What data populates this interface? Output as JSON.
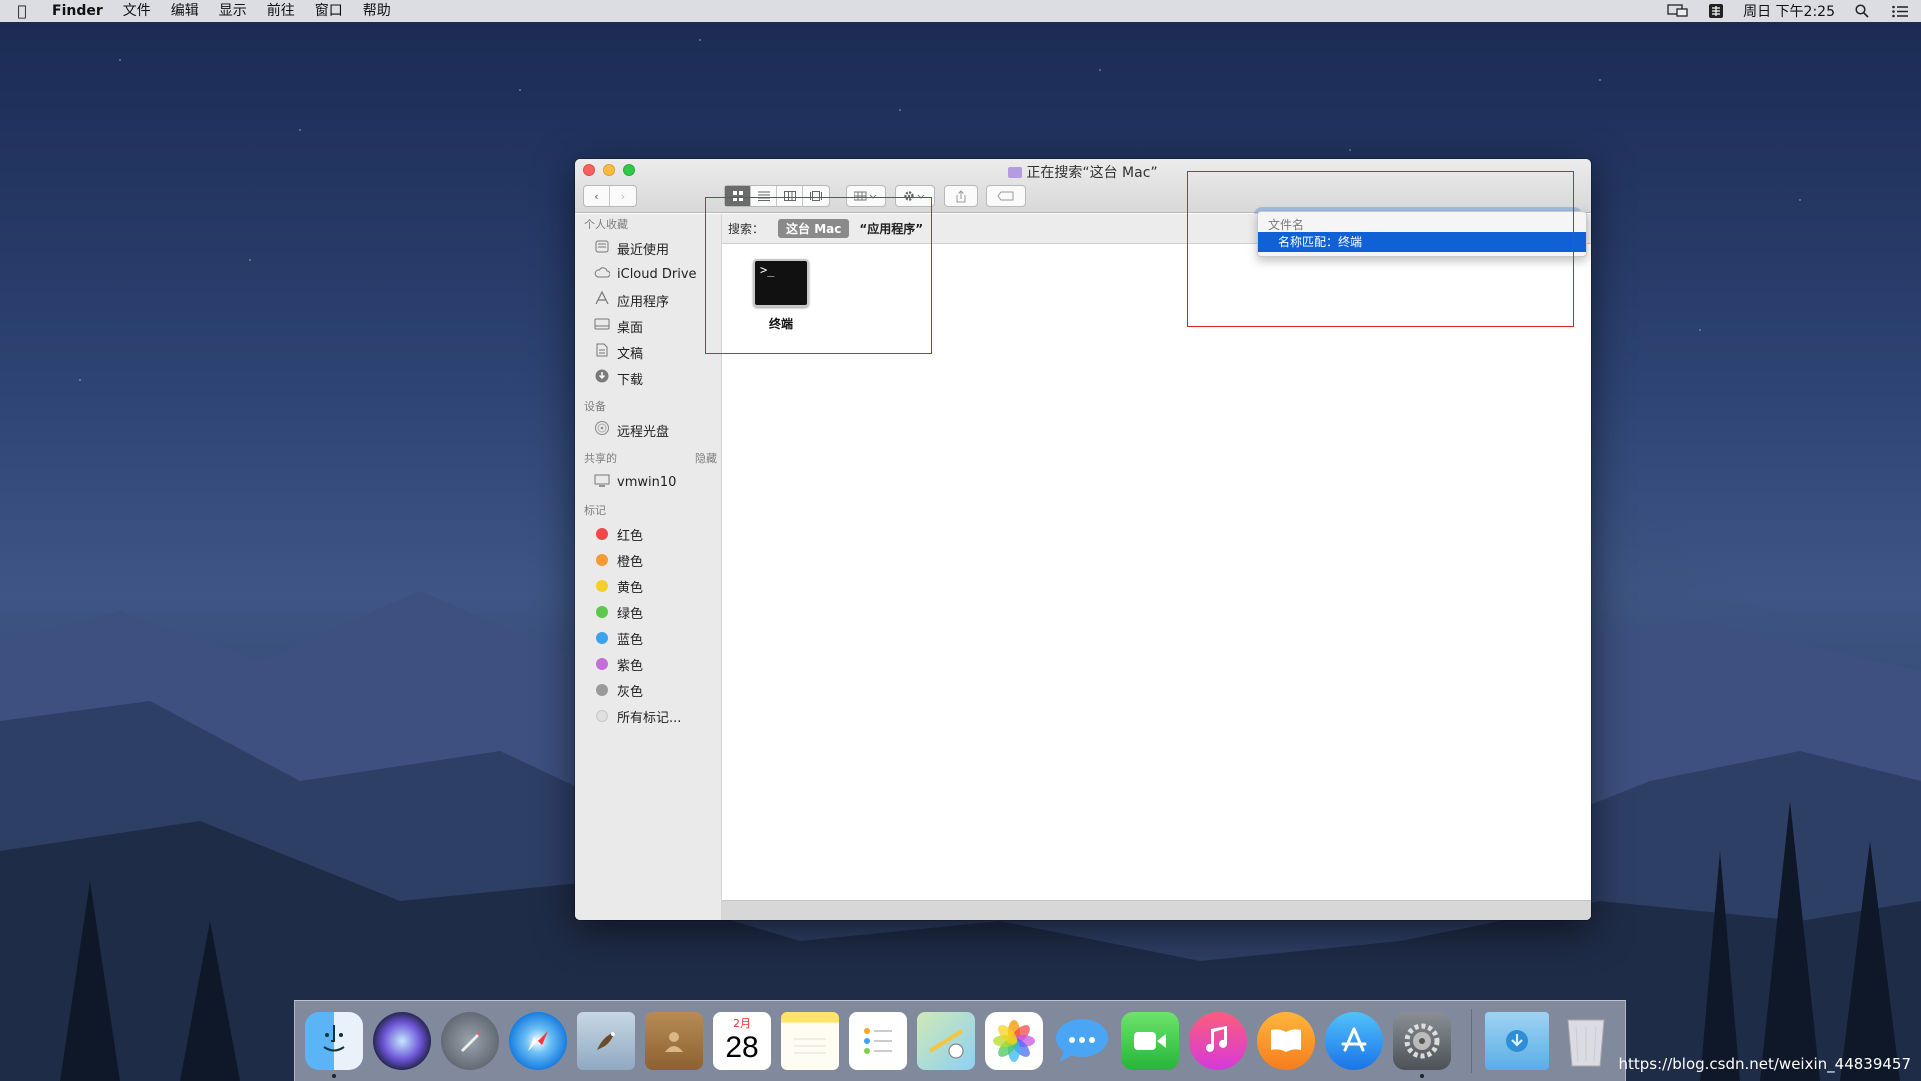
{
  "menubar": {
    "app_name": "Finder",
    "menus": [
      "文件",
      "编辑",
      "显示",
      "前往",
      "窗口",
      "帮助"
    ],
    "clock": "周日 下午2:25"
  },
  "window": {
    "title": "正在搜索“这台 Mac”"
  },
  "search": {
    "value": "终端",
    "suggestions_header": "文件名",
    "suggestion": "名称匹配：终端"
  },
  "scope": {
    "label": "搜索：",
    "this_mac": "这台 Mac",
    "applications": "“应用程序”"
  },
  "sidebar": {
    "favorites_header": "个人收藏",
    "favorites": [
      {
        "label": "最近使用",
        "icon": "clock-icon"
      },
      {
        "label": "iCloud Drive",
        "icon": "cloud-icon"
      },
      {
        "label": "应用程序",
        "icon": "apps-icon"
      },
      {
        "label": "桌面",
        "icon": "desktop-icon"
      },
      {
        "label": "文稿",
        "icon": "document-icon"
      },
      {
        "label": "下载",
        "icon": "download-icon"
      }
    ],
    "devices_header": "设备",
    "devices": [
      {
        "label": "远程光盘",
        "icon": "disc-icon"
      }
    ],
    "shared_header": "共享的",
    "shared_hide": "隐藏",
    "shared": [
      {
        "label": "vmwin10",
        "icon": "computer-icon"
      }
    ],
    "tags_header": "标记",
    "tags": [
      {
        "label": "红色",
        "color": "#f2474a"
      },
      {
        "label": "橙色",
        "color": "#f79a33"
      },
      {
        "label": "黄色",
        "color": "#f6ce2b"
      },
      {
        "label": "绿色",
        "color": "#5dc84a"
      },
      {
        "label": "蓝色",
        "color": "#3aa3ee"
      },
      {
        "label": "紫色",
        "color": "#c46fd9"
      },
      {
        "label": "灰色",
        "color": "#9a9a9a"
      },
      {
        "label": "所有标记...",
        "color": "#e0e0e0"
      }
    ]
  },
  "results": [
    {
      "name": "终端",
      "icon": "terminal-icon",
      "glyph": ">_"
    }
  ],
  "dock": {
    "calendar_month": "2月",
    "calendar_day": "28"
  },
  "watermark": "https://blog.csdn.net/weixin_44839457"
}
